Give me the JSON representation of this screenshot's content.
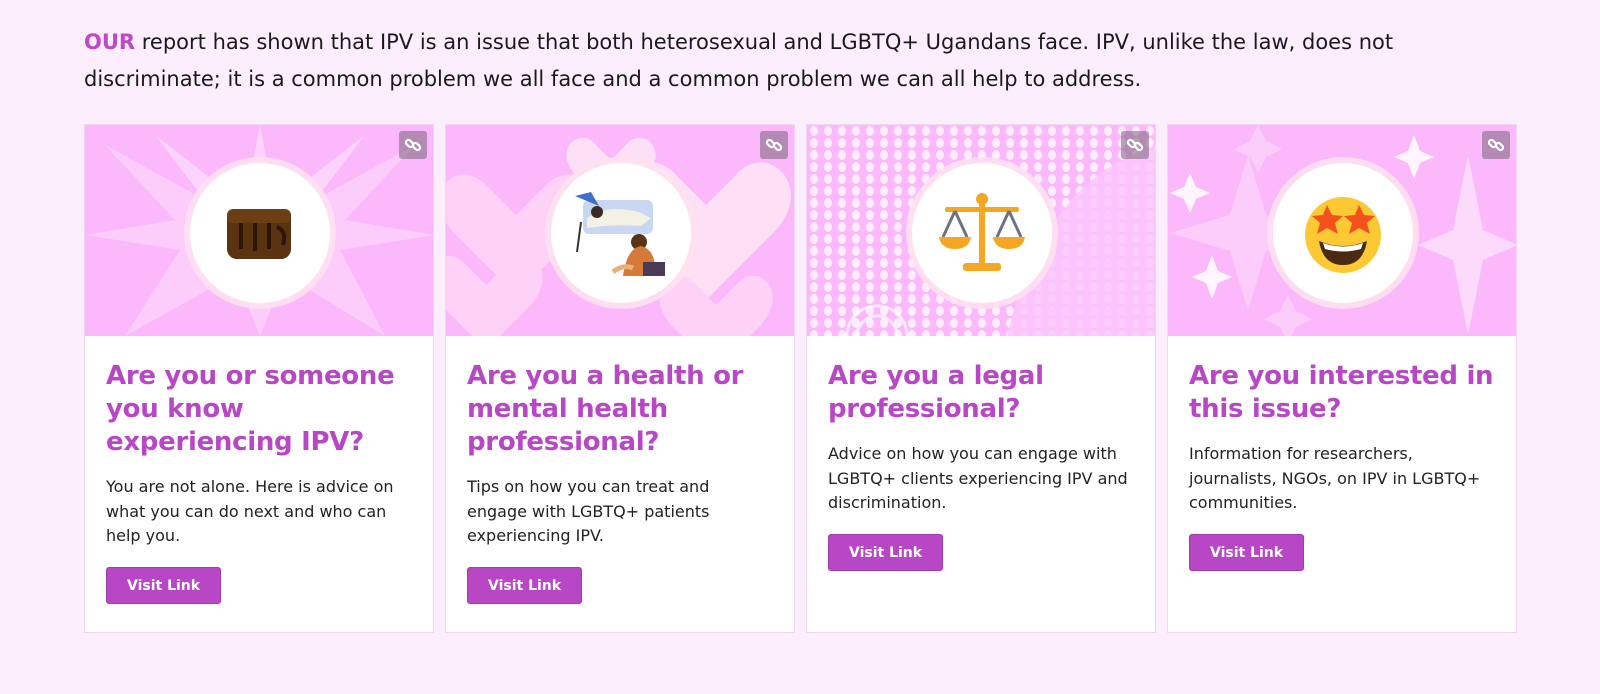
{
  "intro": {
    "lead": "OUR",
    "text": " report has shown that IPV is an issue that both heterosexual and LGBTQ+ Ugandans face. IPV, unlike the law, does not discriminate; it is a common problem we all face and a common problem we can all help to address."
  },
  "colors": {
    "accent": "#b847c5",
    "page_bg": "#fdeefd",
    "media_bg": "#fbb8fb"
  },
  "cards": [
    {
      "title": "Are you or someone you know experiencing IPV?",
      "text": "You are not alone. Here is advice on what you can do next and who can help you.",
      "button": "Visit Link",
      "icon": "raised-fist-icon"
    },
    {
      "title": "Are you a health or mental health professional?",
      "text": "Tips on how you can treat and engage with LGBTQ+ patients experiencing IPV.",
      "button": "Visit Link",
      "icon": "health-illustration-icon"
    },
    {
      "title": "Are you a legal professional?",
      "text": "Advice on how you can engage with LGBTQ+ clients experiencing IPV and discrimination.",
      "button": "Visit Link",
      "icon": "balance-scale-icon"
    },
    {
      "title": "Are you interested in this issue?",
      "text": "Information for researchers, journalists, NGOs, on IPV in LGBTQ+ communities.",
      "button": "Visit Link",
      "icon": "star-struck-icon"
    }
  ]
}
